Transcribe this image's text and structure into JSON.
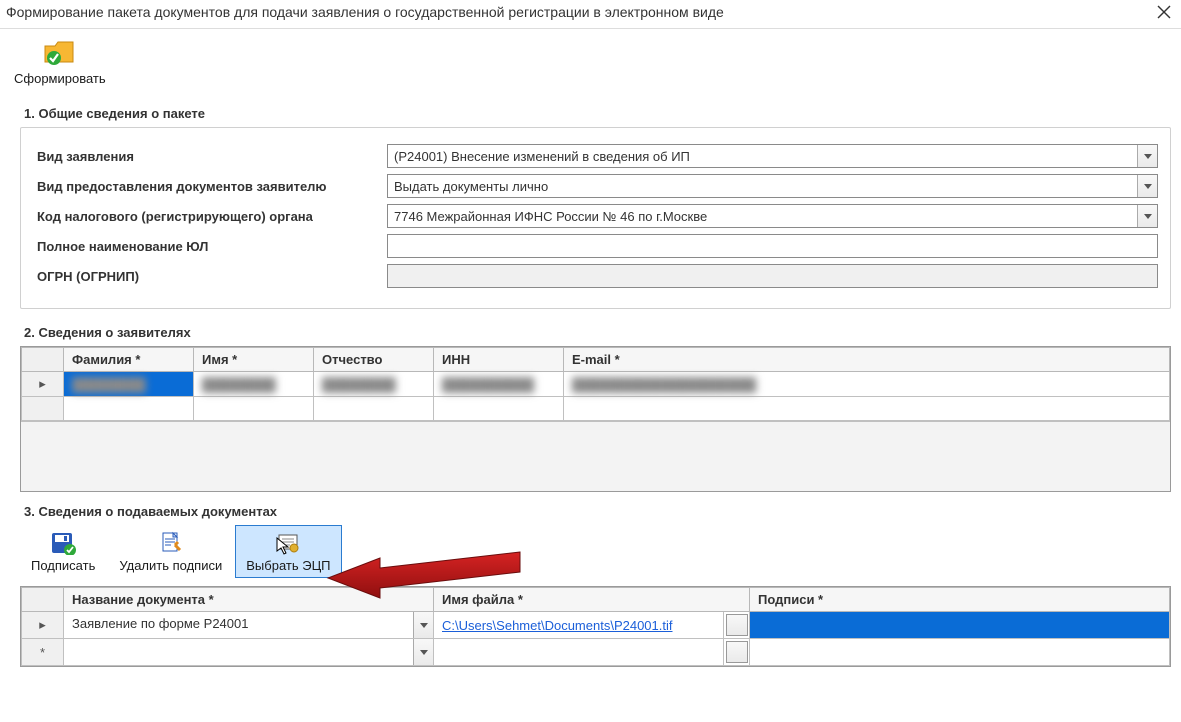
{
  "window": {
    "title": "Формирование пакета документов для подачи заявления о государственной регистрации в электронном виде"
  },
  "toolbar": {
    "form_label": "Сформировать"
  },
  "section1": {
    "title": "1. Общие сведения о пакете",
    "labels": {
      "app_type": "Вид заявления",
      "deliver_type": "Вид предоставления документов заявителю",
      "tax_code": "Код налогового (регистрирующего) органа",
      "full_name": "Полное наименование ЮЛ",
      "ogrn": "ОГРН (ОГРНИП)"
    },
    "values": {
      "app_type": "(Р24001) Внесение изменений в сведения об ИП",
      "deliver_type": "Выдать документы лично",
      "tax_code": "7746 Межрайонная ИФНС России № 46 по г.Москве",
      "full_name": "",
      "ogrn": ""
    }
  },
  "section2": {
    "title": "2. Сведения о заявителях",
    "columns": {
      "lastname": "Фамилия *",
      "firstname": "Имя *",
      "patronymic": "Отчество",
      "inn": "ИНН",
      "email": "E-mail *"
    },
    "rows": [
      {
        "lastname": "████████",
        "firstname": "████████",
        "patronymic": "████████",
        "inn": "██████████",
        "email": "████████████████████"
      }
    ]
  },
  "section3": {
    "title": "3. Сведения о подаваемых документах",
    "buttons": {
      "sign": "Подписать",
      "remove_signs": "Удалить подписи",
      "select_ecp": "Выбрать ЭЦП"
    },
    "columns": {
      "docname": "Название документа *",
      "filename": "Имя файла *",
      "signs": "Подписи *"
    },
    "rows": [
      {
        "docname": "Заявление по форме Р24001",
        "filename": "C:\\Users\\Sehmet\\Documents\\P24001.tif",
        "signs": ""
      }
    ]
  }
}
